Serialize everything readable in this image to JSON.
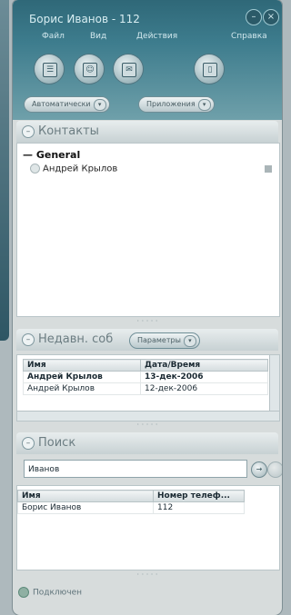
{
  "window": {
    "title": "Борис Иванов - 112",
    "minimize_glyph": "–",
    "close_glyph": "×"
  },
  "menu": [
    "Файл",
    "Вид",
    "Действия",
    "Справка"
  ],
  "toolbar": {
    "buttons": [
      {
        "icon": "contacts-book-icon",
        "glyph": "☰"
      },
      {
        "icon": "chat-icon",
        "glyph": "☺"
      },
      {
        "icon": "message-icon",
        "glyph": "✉"
      },
      {
        "icon": "trash-icon",
        "glyph": "▯"
      }
    ],
    "dropdowns": [
      {
        "label": "Автоматически",
        "arrow": "▾"
      },
      {
        "label": "Приложения",
        "arrow": "▾"
      }
    ]
  },
  "contacts": {
    "title": "Контакты",
    "collapse_glyph": "–",
    "group": "— General",
    "items": [
      "Андрей Крылов"
    ]
  },
  "recent": {
    "title": "Недавн. соб",
    "filter_label": "Параметры",
    "columns": [
      "Имя",
      "Дата/Время"
    ],
    "rows": [
      {
        "name": "Андрей Крылов",
        "date": "13-дек-2006",
        "bold": true
      },
      {
        "name": "Андрей Крылов",
        "date": "12-дек-2006",
        "bold": false
      }
    ]
  },
  "search": {
    "title": "Поиск",
    "value": "Иванов",
    "go_glyph": "→",
    "columns": [
      "Имя",
      "Номер телеф..."
    ],
    "rows": [
      {
        "name": "Борис Иванов",
        "phone": "112"
      }
    ]
  },
  "status": {
    "text": "Подключен"
  },
  "colors": {
    "titlebar": "#3d7c8d",
    "accent": "#6fa0aa",
    "panel": "#d7dcdc"
  }
}
